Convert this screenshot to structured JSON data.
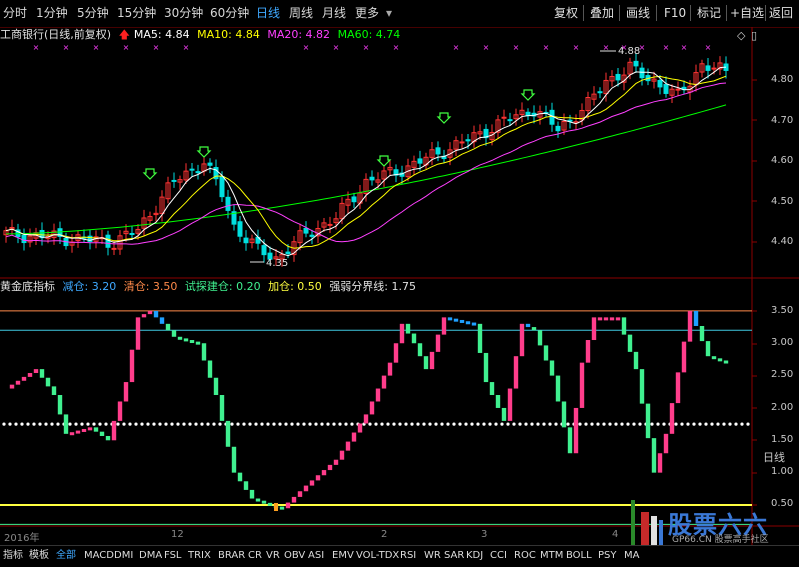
{
  "toolbar": {
    "timeframes": [
      "分时",
      "1分钟",
      "5分钟",
      "15分钟",
      "30分钟",
      "60分钟",
      "日线",
      "周线",
      "月线",
      "更多"
    ],
    "active_timeframe": "日线",
    "buttons": [
      "复权",
      "叠加",
      "画线",
      "F10",
      "标记",
      "+自选",
      "返回"
    ]
  },
  "main_legend": {
    "stock": "工商银行(日线,前复权)",
    "ma5": "MA5: 4.84",
    "ma10": "MA10: 4.84",
    "ma20": "MA20: 4.82",
    "ma60": "MA60: 4.74"
  },
  "price_axis": [
    "4.80",
    "4.70",
    "4.60",
    "4.50",
    "4.40"
  ],
  "annotations": {
    "high": "4.88",
    "low": "4.35"
  },
  "indicator_legend": {
    "name": "黄金底指标",
    "jiancang": "减仓: 3.20",
    "qingcang": "清仓: 3.50",
    "shitan": "试探建仓: 0.20",
    "jiacang": "加仓: 0.50",
    "qiangruo": "强弱分界线: 1.75"
  },
  "indicator_axis": [
    "3.50",
    "3.00",
    "2.50",
    "2.00",
    "1.50",
    "1.00",
    "0.50"
  ],
  "indicator_axis_extra": "日线",
  "date_labels": {
    "year": "2016年",
    "m12": "12",
    "m2": "2",
    "m3": "3",
    "m4": "4"
  },
  "bottom_tabs": [
    "指标",
    "模板",
    "全部",
    "MACD",
    "DMI",
    "DMA",
    "FSL",
    "TRIX",
    "BRAR",
    "CR",
    "VR",
    "OBV",
    "ASI",
    "EMV",
    "VOL-TDX",
    "RSI",
    "WR",
    "SAR",
    "KDJ",
    "CCI",
    "ROC",
    "MTM",
    "BOLL",
    "PSY",
    "MA"
  ],
  "active_bottom_tab": "全部",
  "watermark": {
    "title": "股票六六",
    "sub": "GP66.CN 股票高手社区"
  },
  "colors": {
    "up": "#ff3333",
    "down": "#00e0e0",
    "ma5": "#ffffff",
    "ma10": "#ffff00",
    "ma20": "#ff40ff",
    "ma60": "#00ff00",
    "pink": "#ff3d8b",
    "green": "#40f090",
    "blue": "#1fa0ff"
  }
}
